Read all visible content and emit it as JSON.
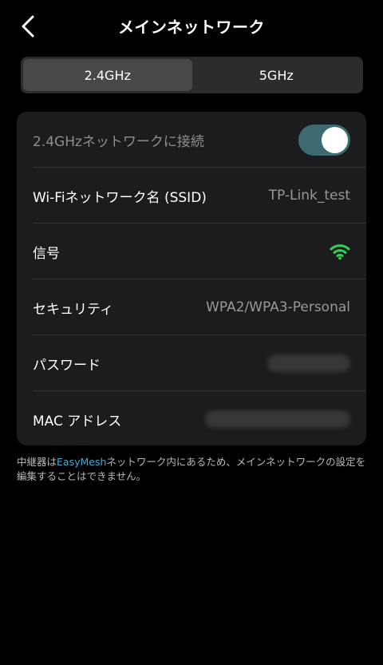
{
  "header": {
    "title": "メインネットワーク"
  },
  "band_toggle": {
    "tabs": [
      {
        "label": "2.4GHz",
        "active": true
      },
      {
        "label": "5GHz",
        "active": false
      }
    ]
  },
  "settings": {
    "connect_label": "2.4GHzネットワークに接続",
    "connect_enabled": true,
    "ssid_label": "Wi-Fiネットワーク名 (SSID)",
    "ssid_value": "TP-Link_test",
    "signal_label": "信号",
    "signal_icon": "wifi-strong-icon",
    "security_label": "セキュリティ",
    "security_value": "WPA2/WPA3-Personal",
    "password_label": "パスワード",
    "mac_label": "MAC アドレス"
  },
  "footnote": {
    "prefix": "中継器は",
    "link": "EasyMesh",
    "suffix": "ネットワーク内にあるため、メインネットワークの設定を編集することはできません。"
  },
  "colors": {
    "accent_green": "#30d158",
    "toggle_on": "#3e6b72",
    "link": "#4aa8d8"
  }
}
